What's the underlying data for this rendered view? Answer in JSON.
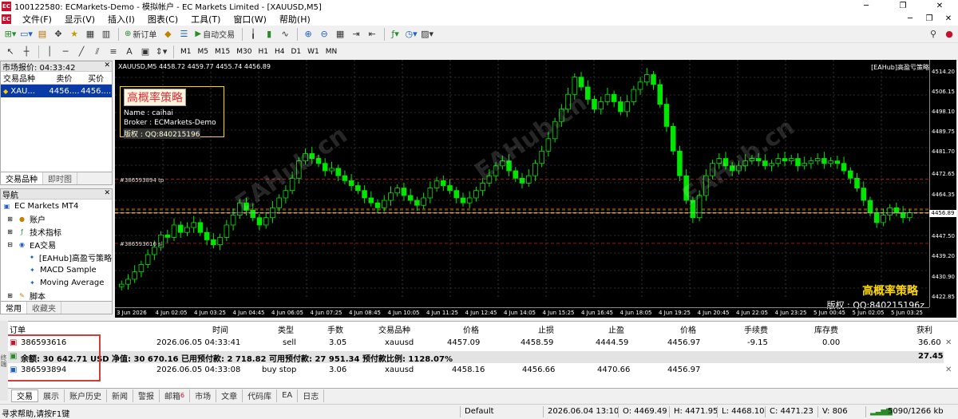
{
  "window": {
    "title": "100122580: ECMarkets-Demo - 模拟帐户 - EC Markets Limited - [XAUUSD,M5]",
    "app_badge": "EC"
  },
  "menu": [
    "文件(F)",
    "显示(V)",
    "插入(I)",
    "图表(C)",
    "工具(T)",
    "窗口(W)",
    "帮助(H)"
  ],
  "toolbar": {
    "new_order": "新订单",
    "auto_trading": "自动交易",
    "timeframes": [
      "M1",
      "M5",
      "M15",
      "M30",
      "H1",
      "H4",
      "D1",
      "W1",
      "MN"
    ]
  },
  "market_watch": {
    "title": "市场报价: 04:33:42",
    "columns": [
      "交易品种",
      "卖价",
      "买价"
    ],
    "rows": [
      {
        "symbol": "XAU...",
        "bid": "4456....",
        "ask": "4456...."
      }
    ],
    "tabs": [
      "交易品种",
      "即时图"
    ]
  },
  "navigator": {
    "title": "导航",
    "root": "EC Markets MT4",
    "items": [
      "账户",
      "技术指标",
      "EA交易"
    ],
    "eas": [
      "[EAHub]高盈亏策略",
      "MACD Sample",
      "Moving Average"
    ],
    "scripts": "脚本",
    "tabs": [
      "常用",
      "收藏夹"
    ]
  },
  "chart": {
    "header": "XAUUSD,M5  4458.72 4459.77 4455.74 4456.89",
    "ea_label": "[EAHub]高盈亏策略",
    "info_title": "高概率策略",
    "info_name": "Name : caihai",
    "info_broker": "Broker : ECMarkets-Demo",
    "info_copyright": "版权 : QQ:840215196",
    "brand": "高概率策略",
    "brand_copyright": "版权 : QQ:840215196z",
    "current_price": "4456.89",
    "line_label_1": "#386593894 tp",
    "line_label_2": "#386593616 sl",
    "watermark": "EAHub.cn",
    "price_labels": [
      "4514.20",
      "4506.15",
      "4498.10",
      "4489.75",
      "4481.70",
      "4472.65",
      "4464.35",
      "4447.50",
      "4439.20",
      "4430.90",
      "4422.85"
    ],
    "time_labels": [
      "3 Jun 2026",
      "4 Jun 02:05",
      "4 Jun 03:25",
      "4 Jun 04:45",
      "4 Jun 06:05",
      "4 Jun 07:25",
      "4 Jun 08:45",
      "4 Jun 10:05",
      "4 Jun 11:25",
      "4 Jun 12:45",
      "4 Jun 14:05",
      "4 Jun 15:25",
      "4 Jun 16:45",
      "4 Jun 18:05",
      "4 Jun 19:25",
      "4 Jun 20:45",
      "4 Jun 22:05",
      "4 Jun 23:25",
      "5 Jun 00:45",
      "5 Jun 02:05",
      "5 Jun 03:25"
    ]
  },
  "chart_data": {
    "type": "candlestick",
    "ylim": [
      4422.85,
      4519.0
    ],
    "closes": [
      4428,
      4430,
      4433,
      4436,
      4440,
      4443,
      4448,
      4447,
      4452,
      4449,
      4451,
      4453,
      4449,
      4446,
      4444,
      4447,
      4452,
      4456,
      4461,
      4458,
      4455,
      4452,
      4455,
      4459,
      4463,
      4466,
      4471,
      4478,
      4481,
      4479,
      4477,
      4474,
      4475,
      4472,
      4470,
      4468,
      4466,
      4463,
      4461,
      4459,
      4462,
      4465,
      4467,
      4464,
      4462,
      4460,
      4463,
      4467,
      4470,
      4468,
      4466,
      4463,
      4461,
      4463,
      4466,
      4469,
      4472,
      4476,
      4478,
      4474,
      4471,
      4469,
      4472,
      4477,
      4482,
      4487,
      4494,
      4499,
      4505,
      4512,
      4508,
      4503,
      4499,
      4502,
      4505,
      4502,
      4498,
      4502,
      4507,
      4510,
      4513,
      4509,
      4501,
      4492,
      4482,
      4472,
      4462,
      4455,
      4464,
      4472,
      4477,
      4479,
      4476,
      4474,
      4476,
      4478,
      4479,
      4478,
      4476,
      4477,
      4479,
      4478,
      4479,
      4476,
      4477,
      4478,
      4479,
      4477,
      4478,
      4477,
      4474,
      4471,
      4467,
      4462,
      4457,
      4453,
      4456,
      4459,
      4457,
      4455,
      4457
    ]
  },
  "terminal": {
    "side_label": "终端",
    "columns": [
      "订单",
      "时间",
      "类型",
      "手数",
      "交易品种",
      "价格",
      "止损",
      "止盈",
      "价格",
      "手续费",
      "库存费",
      "获利"
    ],
    "orders": [
      {
        "ticket": "386593616",
        "time": "2026.06.05 04:33:41",
        "type": "sell",
        "lots": "3.05",
        "symbol": "xauusd",
        "price": "4457.09",
        "sl": "4458.59",
        "tp": "4444.59",
        "cur": "4456.97",
        "commission": "-9.15",
        "swap": "0.00",
        "profit": "36.60"
      },
      {
        "ticket": "386593894",
        "time": "2026.06.05 04:33:08",
        "type": "buy stop",
        "lots": "3.06",
        "symbol": "xauusd",
        "price": "4458.16",
        "sl": "4456.66",
        "tp": "4470.66",
        "cur": "4456.97",
        "commission": "",
        "swap": "",
        "profit": ""
      }
    ],
    "balance": "余额: 30 642.71 USD  净值: 30 670.16  已用预付款: 2 718.82  可用预付款: 27 951.34  预付款比例: 1128.07%",
    "balance_profit": "27.45",
    "tabs": [
      "交易",
      "展示",
      "账户历史",
      "新闻",
      "警报",
      "邮箱",
      "市场",
      "文章",
      "代码库",
      "EA",
      "日志"
    ],
    "mail_count": "6"
  },
  "status": {
    "help": "寻求帮助,请按F1键",
    "profile": "Default",
    "datetime": "2026.06.04 13:10",
    "open": "O: 4469.49",
    "high": "H: 4471.95",
    "low": "L: 4468.10",
    "close": "C: 4471.23",
    "volume": "V: 806",
    "traffic": "5090/1266 kb"
  },
  "colors": {
    "accent": "#c8102e",
    "bull": "#00e600",
    "sl_line": "#c81e1e",
    "cur_line": "#a0a000"
  }
}
